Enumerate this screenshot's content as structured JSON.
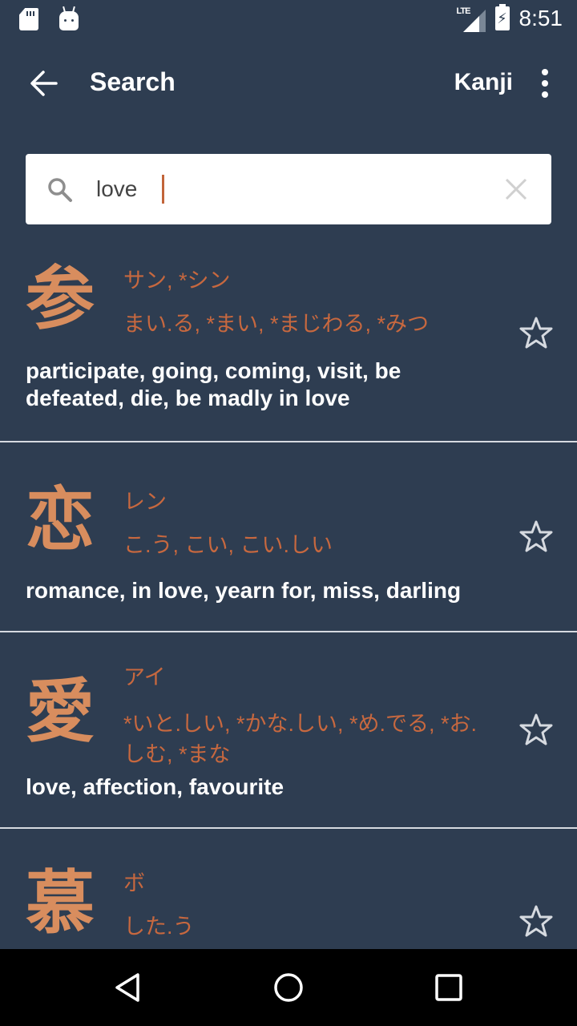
{
  "status_bar": {
    "time": "8:51",
    "network": "LTE",
    "icons": [
      "sd-card-icon",
      "android-bot-icon",
      "lte-signal-icon",
      "battery-charging-icon"
    ]
  },
  "app_bar": {
    "back_icon": "arrow-left-icon",
    "title": "Search",
    "mode_label": "Kanji",
    "more_icon": "more-vert-icon"
  },
  "search": {
    "value": "love",
    "placeholder": "",
    "search_icon": "search-icon",
    "clear_icon": "close-icon"
  },
  "colors": {
    "background": "#2e3d51",
    "kanji": "#d88d5e",
    "reading": "#c7683f",
    "meaning": "#ffffff",
    "divider": "#d6dae0",
    "caret": "#c2653a"
  },
  "results": [
    {
      "kanji": "参",
      "on_reading": "サン, *シン",
      "kun_reading": "まい.る, *まい, *まじわる, *みつ",
      "meaning": "participate, going, coming, visit, be defeated, die, be madly in love",
      "favorite": false
    },
    {
      "kanji": "恋",
      "on_reading": "レン",
      "kun_reading": "こ.う, こい, こい.しい",
      "meaning": "romance, in love, yearn for, miss, darling",
      "favorite": false
    },
    {
      "kanji": "愛",
      "on_reading": "アイ",
      "kun_reading": "*いと.しい, *かな.しい, *め.でる, *お.しむ, *まな",
      "meaning": "love, affection, favourite",
      "favorite": false
    },
    {
      "kanji": "慕",
      "on_reading": "ボ",
      "kun_reading": "した.う",
      "meaning": "",
      "favorite": false
    }
  ],
  "nav_bar": {
    "back": "nav-back-icon",
    "home": "nav-home-icon",
    "recents": "nav-recents-icon"
  }
}
